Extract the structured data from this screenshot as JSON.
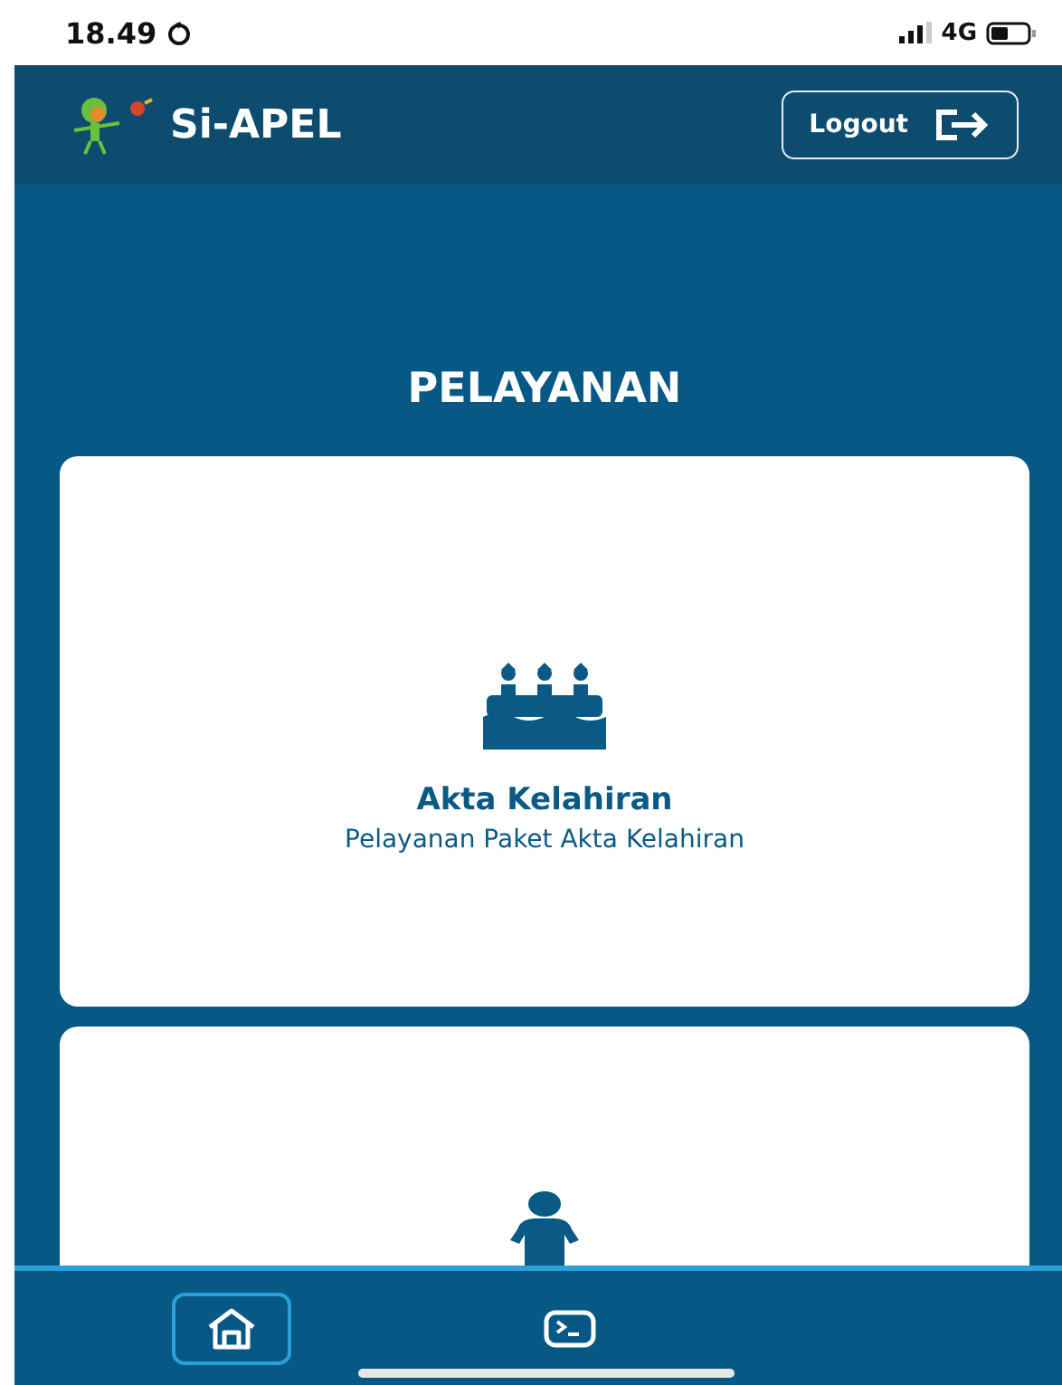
{
  "status_bar": {
    "time": "18.49",
    "network": "4G"
  },
  "header": {
    "title": "Si-APEL",
    "logout_button": "Logout"
  },
  "page_title": "PELAYANAN",
  "services": [
    {
      "kind": "birth",
      "title": "Akta Kelahiran",
      "subtitle": "Pelayanan Paket Akta Kelahiran"
    },
    {
      "kind": "person"
    }
  ],
  "bottom_nav": [
    {
      "kind": "home",
      "selected": true
    },
    {
      "kind": "terminal",
      "selected": false
    }
  ]
}
